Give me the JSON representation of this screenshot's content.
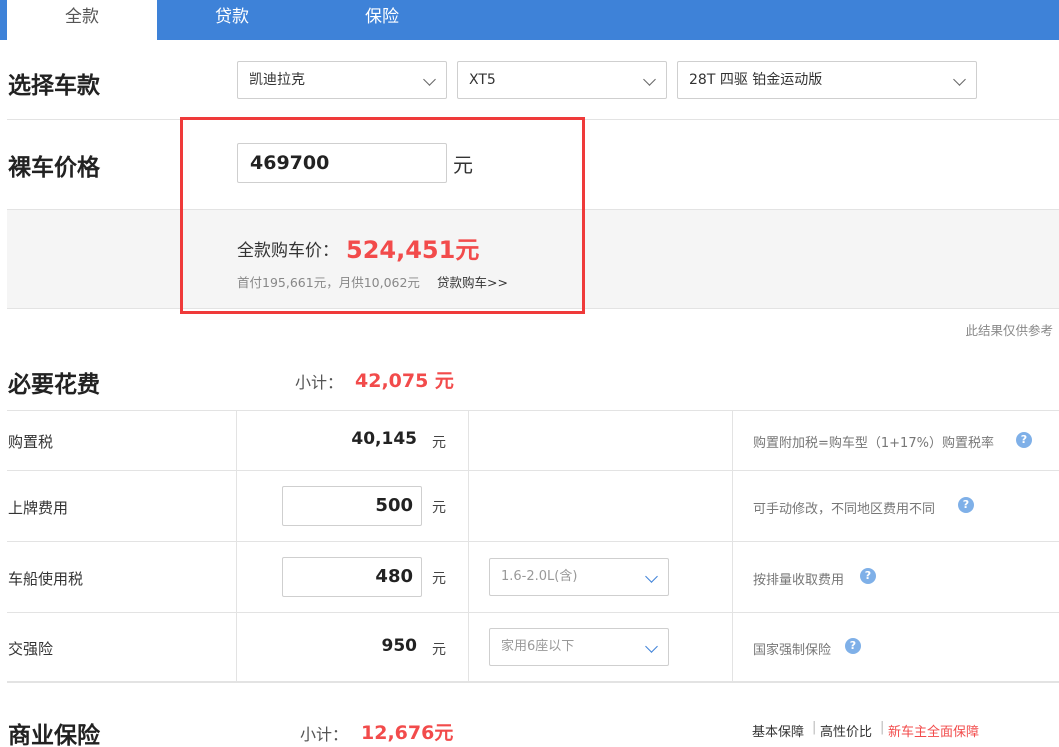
{
  "tabs": [
    {
      "label": "全款",
      "active": true
    },
    {
      "label": "贷款",
      "active": false
    },
    {
      "label": "保险",
      "active": false
    }
  ],
  "select_model": {
    "title": "选择车款",
    "brand": "凯迪拉克",
    "series": "XT5",
    "trim": "28T 四驱 铂金运动版"
  },
  "bare_price": {
    "title": "裸车价格",
    "value": "469700",
    "unit": "元"
  },
  "summary": {
    "total_label": "全款购车价：",
    "total_value": "524,451元",
    "sub_info": "首付195,661元，月供10,062元",
    "loan_link": "贷款购车>>"
  },
  "disclaimer": "此结果仅供参考",
  "required_fees": {
    "title": "必要花费",
    "subtotal_label": "小计：",
    "subtotal_value": "42,075 元",
    "rows": [
      {
        "label": "购置税",
        "value": "40,145",
        "unit": "元",
        "hint": "购置附加税=购车型（1+17%）购置税率"
      },
      {
        "label": "上牌费用",
        "value": "500",
        "unit": "元",
        "hint": "可手动修改，不同地区费用不同"
      },
      {
        "label": "车船使用税",
        "value": "480",
        "unit": "元",
        "option": "1.6-2.0L(含)",
        "hint": "按排量收取费用"
      },
      {
        "label": "交强险",
        "value": "950",
        "unit": "元",
        "option": "家用6座以下",
        "hint": "国家强制保险"
      }
    ]
  },
  "commercial_insurance": {
    "title": "商业保险",
    "subtotal_label": "小计：",
    "subtotal_value": "12,676元",
    "plans": [
      "基本保障",
      "高性价比",
      "新车主全面保障"
    ]
  },
  "colors": {
    "tab_bar": "#3e82d8",
    "accent_red": "#f24b4b",
    "highlight_border": "#ef3a3a",
    "help_icon": "#7fb0e8"
  },
  "icons": {
    "dropdown": "chevron-down-icon",
    "help": "question-circle-icon"
  }
}
